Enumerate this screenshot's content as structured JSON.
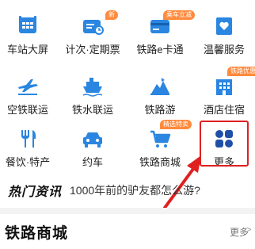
{
  "services": [
    {
      "label": "车站大屏",
      "icon": "station-screen-icon",
      "badge": ""
    },
    {
      "label": "计次·定期票",
      "icon": "ticket-icon",
      "badge": "新"
    },
    {
      "label": "铁路e卡通",
      "icon": "e-card-icon",
      "badge": "乘车立减"
    },
    {
      "label": "温馨服务",
      "icon": "heart-service-icon",
      "badge": ""
    },
    {
      "label": "空铁联运",
      "icon": "plane-train-icon",
      "badge": ""
    },
    {
      "label": "铁水联运",
      "icon": "ship-icon",
      "badge": ""
    },
    {
      "label": "铁路游",
      "icon": "tour-icon",
      "badge": ""
    },
    {
      "label": "酒店住宿",
      "icon": "hotel-icon",
      "badge": "铁路优惠"
    },
    {
      "label": "餐饮·特产",
      "icon": "food-icon",
      "badge": ""
    },
    {
      "label": "约车",
      "icon": "car-icon",
      "badge": ""
    },
    {
      "label": "铁路商城",
      "icon": "cart-icon",
      "badge": "精选特卖"
    },
    {
      "label": "更多",
      "icon": "more-icon",
      "badge": ""
    }
  ],
  "news": {
    "tag": "热门资讯",
    "headline": "1000年前的驴友都怎么游?"
  },
  "section": {
    "title": "铁路商城",
    "more_label": "更多",
    "more_arrow": ">"
  },
  "colors": {
    "icon_blue": "#2a86e0",
    "badge_orange": "#ff8a3d",
    "highlight_red": "#e02020"
  }
}
